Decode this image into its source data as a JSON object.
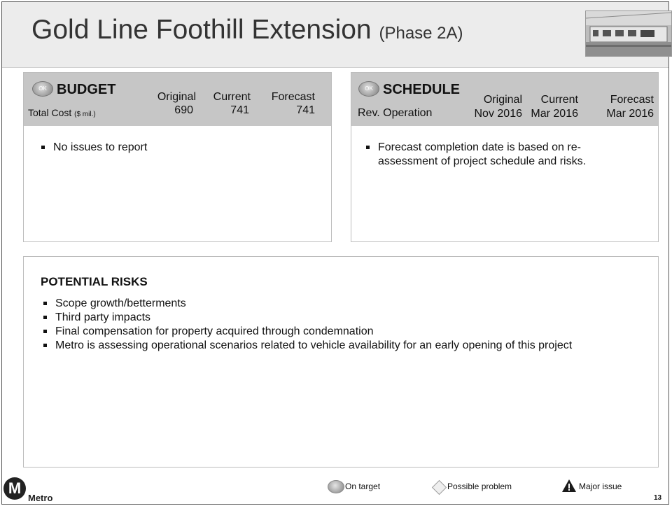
{
  "header": {
    "title": "Gold Line Foothill Extension",
    "subtitle": "(Phase 2A)"
  },
  "budget": {
    "label": "BUDGET",
    "status_icon": "ok-icon",
    "metric_label": "Total Cost",
    "metric_unit": "($ mil.)",
    "columns": [
      "Original",
      "Current",
      "Forecast"
    ],
    "values": [
      "690",
      "741",
      "741"
    ],
    "bullets": [
      "No issues to report"
    ]
  },
  "schedule": {
    "label": "SCHEDULE",
    "status_icon": "ok-icon",
    "metric_label": "Rev. Operation",
    "columns": [
      "Original",
      "Current",
      "Forecast"
    ],
    "values": [
      "Nov 2016",
      "Mar 2016",
      "Mar 2016"
    ],
    "bullets": [
      "Forecast completion date is based on re-assessment of project schedule and risks."
    ]
  },
  "risks": {
    "title": "POTENTIAL RISKS",
    "items": [
      "Scope growth/betterments",
      "Third party impacts",
      "Final compensation for property acquired through condemnation",
      "Metro is assessing operational scenarios related to vehicle availability for an early opening of this project"
    ]
  },
  "legend": {
    "on_target": "On target",
    "possible_problem": "Possible problem",
    "major_issue": "Major issue"
  },
  "footer": {
    "logo_letter": "M",
    "logo_word": "Metro",
    "page_number": "13"
  }
}
